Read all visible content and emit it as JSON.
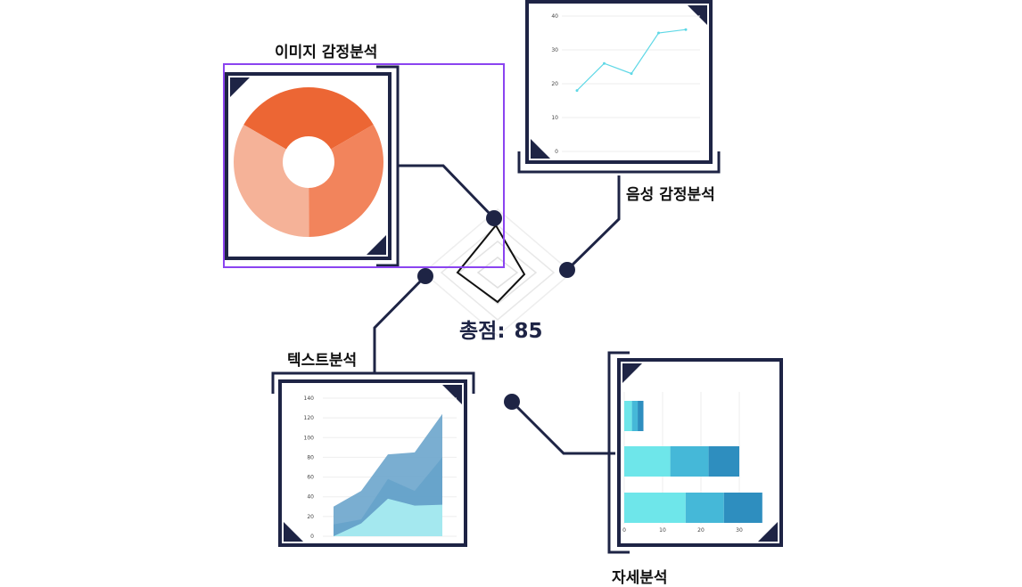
{
  "labels": {
    "image_analysis": "이미지 감정분석",
    "voice_analysis": "음성 감정분석",
    "text_analysis": "텍스트분석",
    "detail_analysis": "자세분석"
  },
  "score": {
    "label": "총점:",
    "value": "85"
  },
  "colors": {
    "frame": "#1e2445",
    "selection": "#8b44f0",
    "donut_dark": "#ec6634",
    "donut_mid": "#f2845c",
    "donut_light": "#f5b298",
    "line": "#5fd8e6",
    "area_back": "#6ba5cc",
    "area_front": "#a8ecf0",
    "bar_1": "#6ee6ea",
    "bar_2": "#45b8d8",
    "bar_3": "#2e8ebf"
  },
  "chart_data": [
    {
      "type": "pie",
      "variant": "donut",
      "values": [
        33.3,
        33.3,
        33.4
      ],
      "colors": [
        "#ec6634",
        "#f2845c",
        "#f5b298"
      ]
    },
    {
      "type": "line",
      "x": [
        1,
        2,
        3,
        4,
        5
      ],
      "values": [
        18,
        26,
        23,
        35,
        36
      ],
      "ylim": [
        0,
        40
      ],
      "yticks": [
        "0",
        "10",
        "20",
        "30",
        "40"
      ],
      "grid": true
    },
    {
      "type": "area",
      "x": [
        1,
        2,
        3,
        4,
        5,
        6
      ],
      "series": [
        {
          "values": [
            30,
            46,
            83,
            85,
            124,
            124
          ]
        },
        {
          "values": [
            12,
            17,
            58,
            46,
            80,
            80
          ]
        },
        {
          "values": [
            0,
            13,
            38,
            31,
            32,
            32
          ]
        }
      ],
      "ylim": [
        0,
        140
      ],
      "yticks": [
        "0",
        "20",
        "40",
        "60",
        "80",
        "100",
        "120",
        "140"
      ],
      "grid": true
    },
    {
      "type": "bar",
      "orientation": "horizontal",
      "stacked": true,
      "series": [
        {
          "values": [
            2,
            12,
            16
          ]
        },
        {
          "values": [
            1.5,
            10,
            10
          ]
        },
        {
          "values": [
            1.5,
            8,
            10
          ]
        }
      ],
      "xlim": [
        0,
        40
      ],
      "xticks": [
        "0",
        "10",
        "20",
        "30"
      ],
      "grid": true
    }
  ]
}
